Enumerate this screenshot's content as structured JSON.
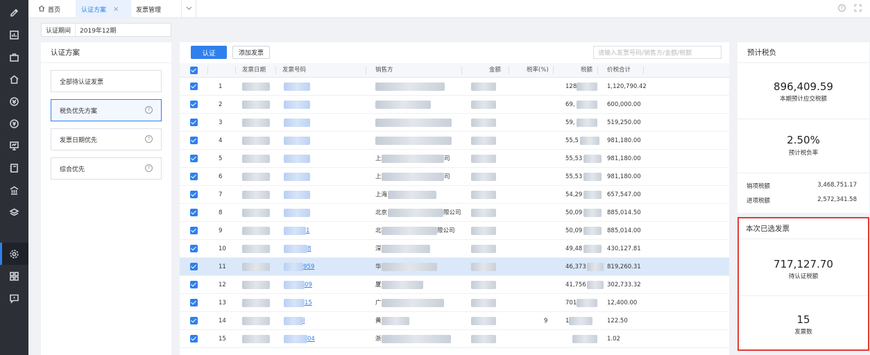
{
  "sidebar": {
    "icons": [
      "edit-icon",
      "report-icon",
      "briefcase-icon",
      "home-icon",
      "tax-icon",
      "yen-icon",
      "monitor-icon",
      "ledger-icon",
      "building-icon",
      "layers-icon",
      "settings-icon",
      "grid-icon",
      "message-icon"
    ],
    "active_index": 10
  },
  "tabs": [
    {
      "label": "首页"
    },
    {
      "label": "认证方案",
      "close": "×"
    },
    {
      "label": "发票管理"
    }
  ],
  "top_right": {
    "help": "?",
    "expand": "⛶"
  },
  "period": {
    "label": "认证期间",
    "value": "2019年12期"
  },
  "plans_panel": {
    "title": "认证方案",
    "items": [
      {
        "label": "全部待认证发票",
        "has_help": false
      },
      {
        "label": "税负优先方案",
        "has_help": true
      },
      {
        "label": "发票日期优先",
        "has_help": true
      },
      {
        "label": "综合优先",
        "has_help": true
      }
    ],
    "help_glyph": "?"
  },
  "toolbar": {
    "certify_label": "认证",
    "add_label": "添加发票",
    "search_placeholder": "请输入发票号码/销售方/金额/税额"
  },
  "table": {
    "columns": [
      "发票日期",
      "发票号码",
      "销售方",
      "金额",
      "税率(%)",
      "税额",
      "价税合计"
    ],
    "rows": [
      {
        "n": "1",
        "buyer": "",
        "tax_rate": "",
        "tax": "128",
        "total": "1,120,790.42",
        "inv_tail": ""
      },
      {
        "n": "2",
        "buyer": "",
        "tax_rate": "",
        "tax": "69,",
        "total": "600,000.00",
        "inv_tail": ""
      },
      {
        "n": "3",
        "buyer": "",
        "tax_rate": "",
        "tax": "59,",
        "total": "519,250.00",
        "inv_tail": ""
      },
      {
        "n": "4",
        "buyer": "",
        "tax_rate": "",
        "tax": "55,5",
        "total": "981,180.00",
        "inv_tail": ""
      },
      {
        "n": "5",
        "buyer": "上",
        "buyer_tail": "司",
        "tax_rate": "",
        "tax": "55,53",
        "total": "981,180.00",
        "inv_tail": ""
      },
      {
        "n": "6",
        "buyer": "上",
        "buyer_tail": "司",
        "tax_rate": "",
        "tax": "55,53",
        "total": "981,180.00",
        "inv_tail": ""
      },
      {
        "n": "7",
        "buyer": "上海",
        "buyer_tail": "",
        "tax_rate": "",
        "tax": "54,29",
        "total": "657,547.00",
        "inv_tail": ""
      },
      {
        "n": "8",
        "buyer": "北京",
        "buyer_tail": "限公司",
        "tax_rate": "",
        "tax": "50,09",
        "total": "885,014.50",
        "inv_tail": ""
      },
      {
        "n": "9",
        "buyer": "北",
        "buyer_tail": "限公司",
        "tax_rate": "",
        "tax": "50,09",
        "total": "885,014.00",
        "inv_tail": "1"
      },
      {
        "n": "10",
        "buyer": "深",
        "buyer_tail": "",
        "tax_rate": "",
        "tax": "49,48",
        "total": "430,127.81",
        "inv_tail": "8"
      },
      {
        "n": "11",
        "buyer": "华",
        "buyer_tail": "",
        "tax_rate": "",
        "tax": "46,373",
        "total": "819,260.31",
        "inv_tail": "959"
      },
      {
        "n": "12",
        "buyer": "厦",
        "buyer_tail": "",
        "tax_rate": "",
        "tax": "41,756",
        "total": "302,733.32",
        "inv_tail": "09"
      },
      {
        "n": "13",
        "buyer": "广",
        "buyer_tail": "",
        "tax_rate": "",
        "tax": "701",
        "total": "12,400.00",
        "inv_tail": "15"
      },
      {
        "n": "14",
        "buyer": "黄",
        "buyer_tail": "",
        "tax_rate": "9",
        "tax": "1",
        "total": "122.50",
        "inv_tail": "l"
      },
      {
        "n": "15",
        "buyer": "浙",
        "buyer_tail": "",
        "tax_rate": "",
        "tax": "",
        "total": "1.02",
        "inv_tail": "04"
      }
    ],
    "selected_row": 11
  },
  "forecast": {
    "title": "预计税负",
    "payable_value": "896,409.59",
    "payable_label": "本期预计应交税额",
    "rate_value": "2.50%",
    "rate_label": "预计税负率",
    "output_label": "销项税额",
    "output_value": "3,468,751.17",
    "input_label": "进项税额",
    "input_value": "2,572,341.58"
  },
  "selected": {
    "title": "本次已选发票",
    "tax_value": "717,127.70",
    "tax_label": "待认证税额",
    "count_value": "15",
    "count_label": "发票数",
    "highlight_color": "#e53935"
  }
}
